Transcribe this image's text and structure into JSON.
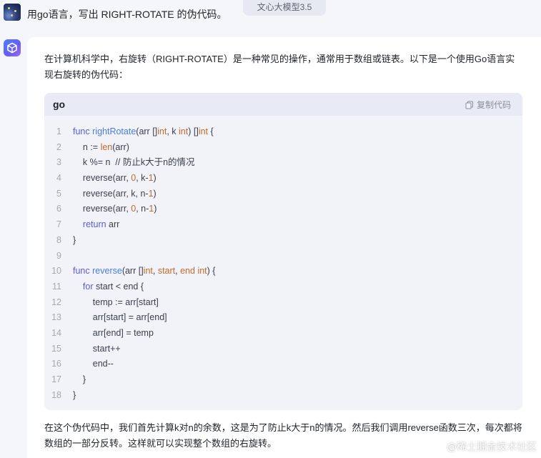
{
  "user": {
    "message": "用go语言，写出 RIGHT-ROTATE 的伪代码。"
  },
  "model_tag": "文心大模型3.5",
  "answer": {
    "intro": "在计算机科学中，右旋转（RIGHT-ROTATE）是一种常见的操作，通常用于数组或链表。以下是一个使用Go语言实现右旋转的伪代码：",
    "code_lang": "go",
    "copy_label": "复制代码",
    "code_lines": [
      "func rightRotate(arr []int, k int) []int {",
      "    n := len(arr)",
      "    k %= n  // 防止k大于n的情况",
      "    reverse(arr, 0, k-1)",
      "    reverse(arr, k, n-1)",
      "    reverse(arr, 0, n-1)",
      "    return arr",
      "}",
      "",
      "func reverse(arr []int, start, end int) {",
      "    for start < end {",
      "        temp := arr[start]",
      "        arr[start] = arr[end]",
      "        arr[end] = temp",
      "        start++",
      "        end--",
      "    }",
      "}"
    ],
    "outro": "在这个伪代码中，我们首先计算k对n的余数，这是为了防止k大于n的情况。然后我们调用reverse函数三次，每次都将数组的一部分反转。这样就可以实现整个数组的右旋转。"
  },
  "watermark": "@稀土掘金技术社区",
  "colors": {
    "background": "#f5f6fa",
    "code_bg": "#f1f3f9",
    "keyword": "#5b5bd6",
    "function": "#4a7de0",
    "number": "#c26a2a"
  }
}
